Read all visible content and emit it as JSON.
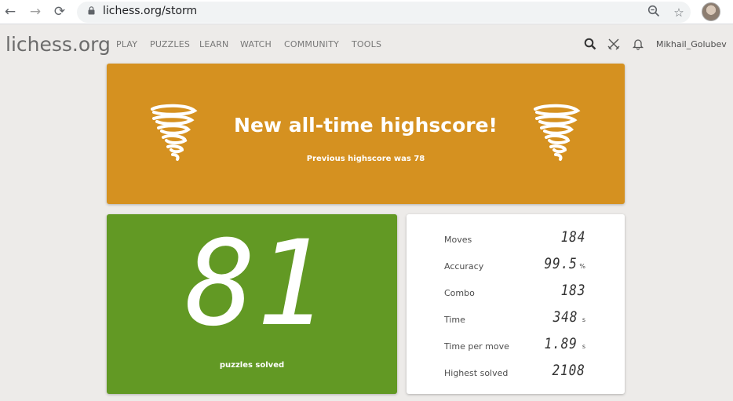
{
  "browser": {
    "url": "lichess.org/storm"
  },
  "header": {
    "logo": "lichess.org",
    "nav": [
      "PLAY",
      "PUZZLES",
      "LEARN",
      "WATCH",
      "COMMUNITY",
      "TOOLS"
    ],
    "username": "Mikhail_Golubev"
  },
  "banner": {
    "title": "New all-time highscore!",
    "subtitle": "Previous highscore was 78",
    "color": "#d59120"
  },
  "score": {
    "value": "81",
    "caption": "puzzles solved",
    "color": "#629924"
  },
  "stats": [
    {
      "label": "Moves",
      "value": "184",
      "unit": ""
    },
    {
      "label": "Accuracy",
      "value": "99.5",
      "unit": "%"
    },
    {
      "label": "Combo",
      "value": "183",
      "unit": ""
    },
    {
      "label": "Time",
      "value": "348",
      "unit": "s"
    },
    {
      "label": "Time per move",
      "value": "1.89",
      "unit": "s"
    },
    {
      "label": "Highest solved",
      "value": "2108",
      "unit": ""
    }
  ]
}
